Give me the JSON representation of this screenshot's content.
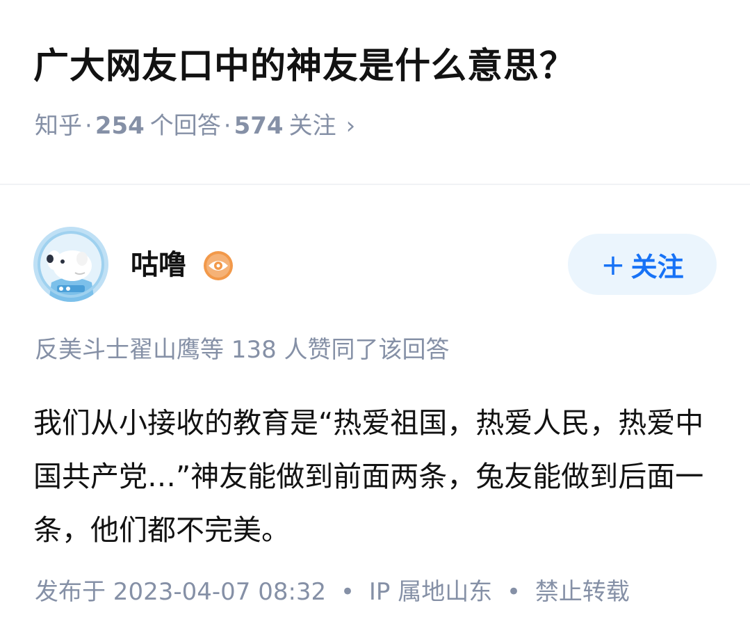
{
  "question": {
    "title": "广大网友口中的神友是什么意思？",
    "source": "知乎",
    "answers_count": "254",
    "answers_label": "个回答",
    "followers_count": "574",
    "followers_label": "关注",
    "separator": "·",
    "chevron": "›"
  },
  "author": {
    "name": "咕噜",
    "avatar_icon": "dog-astronaut-avatar",
    "badge_icon": "eye-badge-icon",
    "follow_label": "关注",
    "follow_plus": "+"
  },
  "voters": {
    "text": "反美斗士翟山鹰等 138 人赞同了该回答"
  },
  "answer": {
    "paragraph": "我们从小接收的教育是“热爱祖国，热爱人民，热爱中国共产党…”神友能做到前面两条，兔友能做到后面一条，他们都不完美。"
  },
  "footer": {
    "published": "发布于 2023-04-07 08:32",
    "ip": "IP 属地山东",
    "copyright": "禁止转载",
    "separator": "•"
  },
  "colors": {
    "title": "#121212",
    "meta": "#8590a6",
    "accent": "#1772f6",
    "follow_bg": "#ebf5fd",
    "divider": "#f0f2f5",
    "badge": "#f2994a"
  }
}
